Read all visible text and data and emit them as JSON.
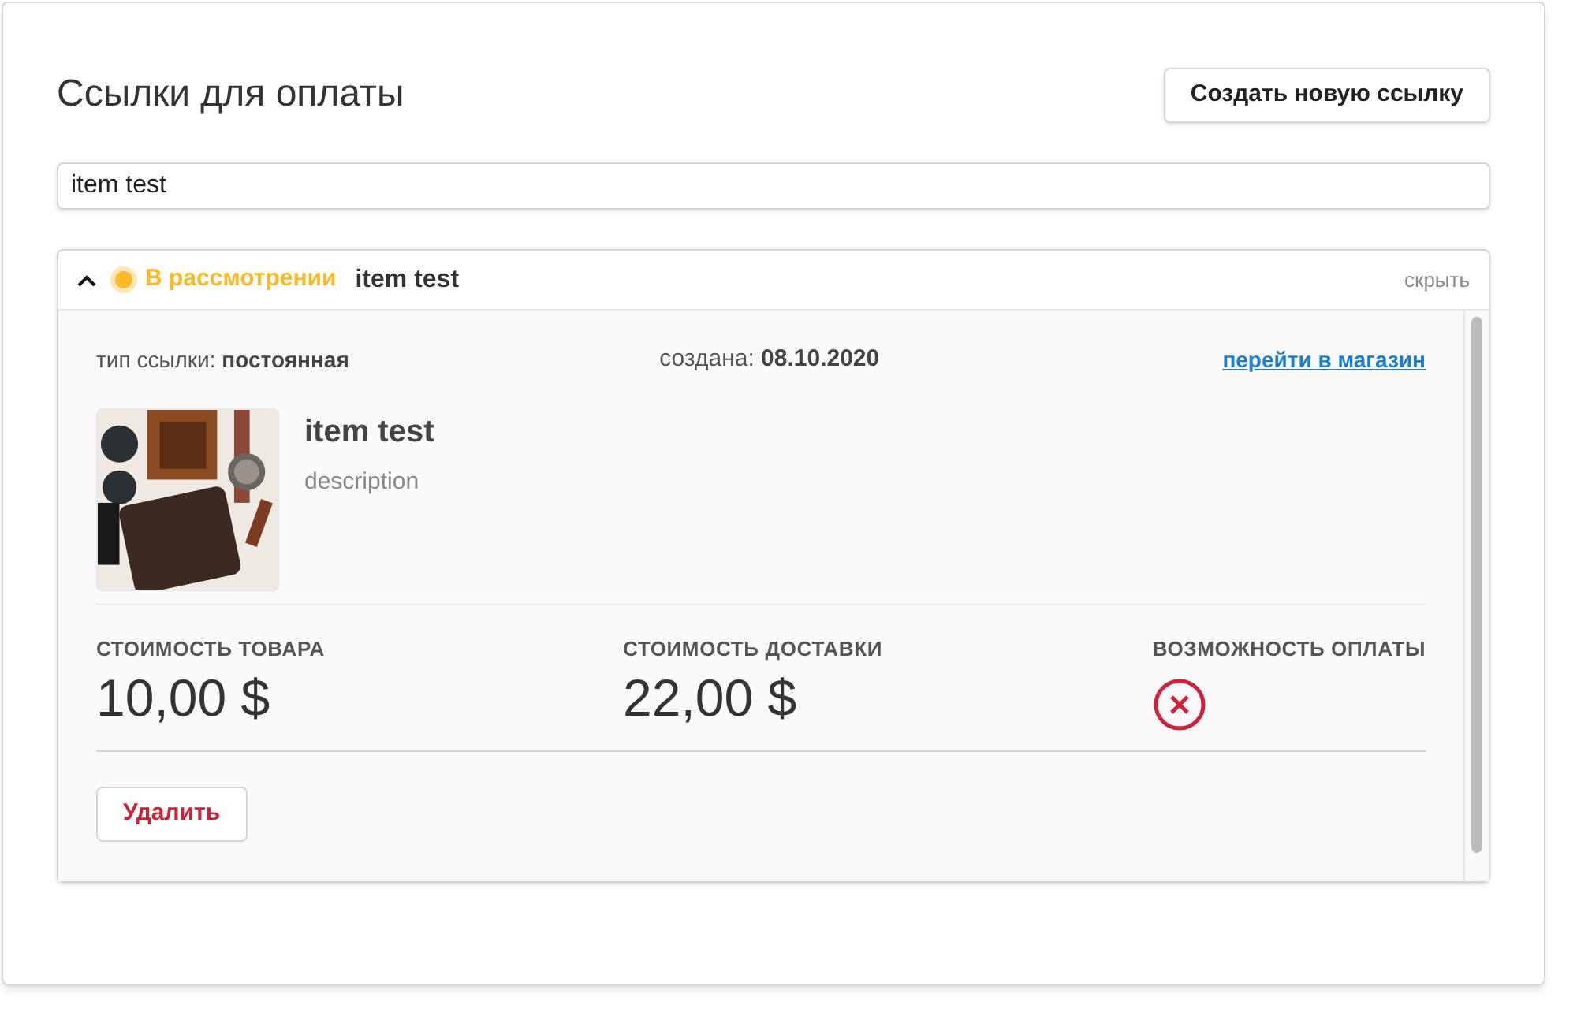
{
  "page": {
    "title": "Ссылки для оплаты",
    "create_button": "Создать новую ссылку"
  },
  "search": {
    "value": "item test"
  },
  "link": {
    "expanded": true,
    "status": {
      "label": "В рассмотрении",
      "color": "#fbb829"
    },
    "name": "item test",
    "hide_label": "скрыть",
    "type_label": "тип ссылки:",
    "type_value": "постоянная",
    "created_label": "создана:",
    "created_value": "08.10.2020",
    "shop_link": "перейти в магазин",
    "product": {
      "title": "item test",
      "description": "description"
    },
    "prices": [
      {
        "label": "СТОИМОСТЬ ТОВАРА",
        "value": "10,00 $"
      },
      {
        "label": "СТОИМОСТЬ ДОСТАВКИ",
        "value": "22,00 $"
      }
    ],
    "payment": {
      "label": "ВОЗМОЖНОСТЬ ОПЛАТЫ",
      "available": false
    },
    "delete_button": "Удалить"
  }
}
